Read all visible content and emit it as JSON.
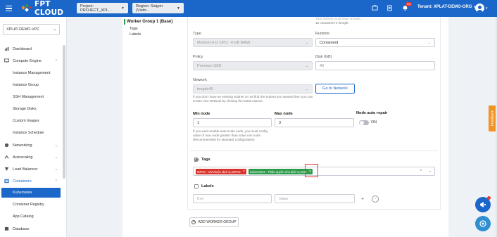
{
  "topbar": {
    "brand": "FPT CLOUD",
    "project_select": "Project: PROJECT_XPL...",
    "region_select": "Region: Saigon (Vietn...",
    "notification_count": "14",
    "tenant": "Tenant: XPLAT-DEMO-ORG"
  },
  "sidebar": {
    "vpc": "XPLAT-DEMO-VPC",
    "items": {
      "dashboard": "Dashboard",
      "compute_engine": "Compute Engine",
      "instance_management": "Instance Management",
      "instance_group": "Instance Group",
      "ssh_management": "SSH Management",
      "storage_disks": "Storage Disks",
      "custom_images": "Custom Images",
      "instance_schedule": "Instance Schedule",
      "networking": "Networking",
      "autoscaling": "Autoscaling",
      "load_balancer": "Load Balancer",
      "containers": "Containers",
      "kubernetes": "Kubernetes",
      "container_registry": "Container Registry",
      "app_catalog": "App Catalog",
      "database": "Database"
    }
  },
  "worker_nav": {
    "title": "Worker Group 1 (Base)",
    "tags": "Tags",
    "labels": "Labels"
  },
  "form": {
    "top_hint_line1": "Your Subnet must have at least...",
    "top_hint_line2": "15 characters in length.",
    "type_label": "Type",
    "type_value": "Medium-4 (2 CPU - 4 GB RAM)",
    "runtime_label": "Runtime",
    "runtime_value": "Containerd",
    "policy_label": "Policy",
    "policy_value": "Premium-SSD",
    "disk_label": "Disk (GB)",
    "disk_value": "40",
    "network_label": "Network",
    "network_value": "tengdn45",
    "network_hint_line1": "If you don't have an existing Subnet or not find the Subnet you wanted then you can",
    "network_hint_line2": "create new Network by clicking the button above.",
    "go_to_network": "Go to Network",
    "min_node_label": "Min node",
    "min_node_value": "1",
    "max_node_label": "Max node",
    "max_node_value": "3",
    "auto_repair_label": "Node auto repair",
    "auto_repair_state": "ON",
    "autoscale_hint_line1": "If you want enable auto-scale node, you must config",
    "autoscale_hint_line2": "value of max node greater than value min node",
    "autoscale_hint_line3": "(Recommended for standard configuration)",
    "tags_title": "Tags",
    "tag1": "MFKE - VM thuộc dịch vụ MFKE",
    "tag2": "Kubernetes - Phân quyền cho dịch vụ K8 t",
    "labels_title": "Labels",
    "key_placeholder": "Key",
    "value_placeholder": "Value",
    "add_worker_group": "ADD WORKER GROUP"
  },
  "feedback": "Feedback",
  "colors": {
    "primary": "#1a66c9",
    "tag_red": "#d9342b",
    "tag_green": "#2e9a4a",
    "highlight": "#e53935",
    "feedback": "#f29423"
  }
}
